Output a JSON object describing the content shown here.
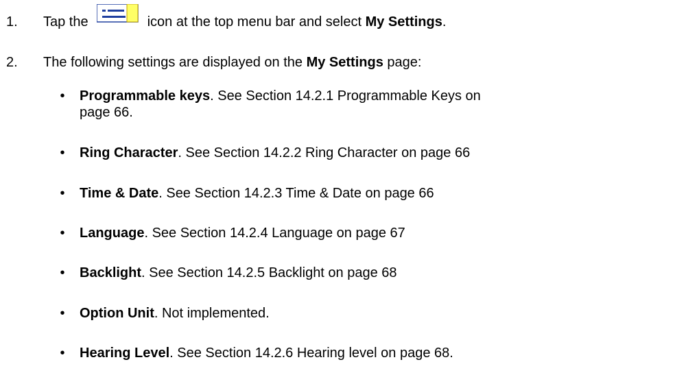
{
  "steps": [
    {
      "number": "1.",
      "text_before_icon": "Tap the",
      "icon": "settings-menu-icon",
      "text_after_icon": "icon at the top menu bar and select",
      "bold": "My Settings",
      "end": "."
    },
    {
      "number": "2.",
      "text_before": "The following settings are displayed on the",
      "bold": "My Settings",
      "text_after": "page:"
    }
  ],
  "settings": [
    {
      "bullet": "•",
      "name": "Programmable keys",
      "description_line1": ". See Section 14.2.1 Programmable Keys on",
      "description_line2": "page 66."
    },
    {
      "bullet": "•",
      "name": "Ring Character",
      "description": ". See Section 14.2.2 Ring Character on page 66"
    },
    {
      "bullet": "•",
      "name": "Time & Date",
      "description": ". See Section 14.2.3 Time & Date on page 66"
    },
    {
      "bullet": "•",
      "name": "Language",
      "description": ". See Section 14.2.4 Language on page 67"
    },
    {
      "bullet": "•",
      "name": "Backlight",
      "description": ". See Section 14.2.5 Backlight on page 68"
    },
    {
      "bullet": "•",
      "name": "Option Unit",
      "description": ". Not implemented."
    },
    {
      "bullet": "•",
      "name": "Hearing Level",
      "description": ". See Section 14.2.6 Hearing level on page 68."
    }
  ],
  "colors": {
    "text": "#000000",
    "icon_yellow": "#ffff66",
    "icon_blue": "#1f3f9f"
  }
}
